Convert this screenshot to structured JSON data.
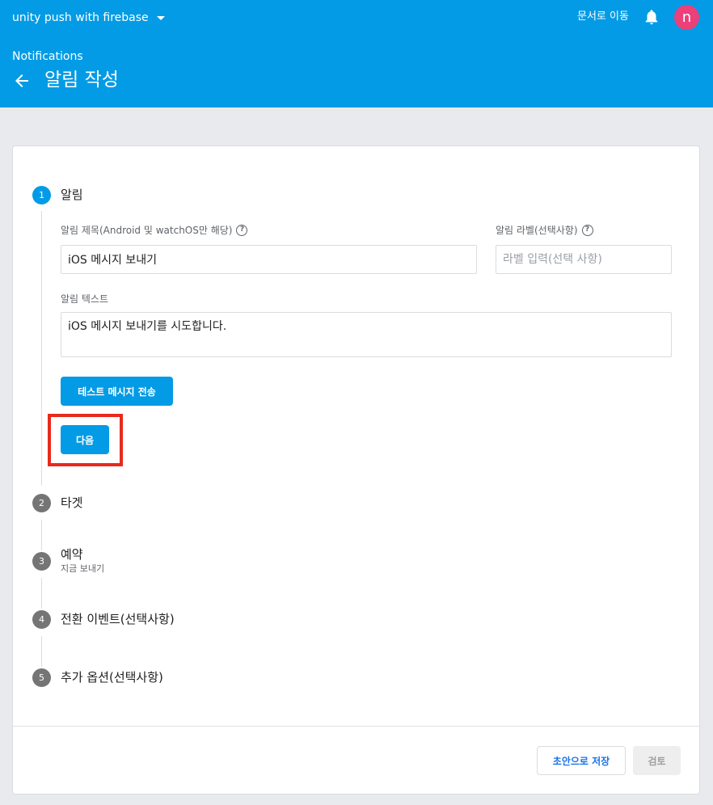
{
  "header": {
    "project_name": "unity push with firebase",
    "docs_link": "문서로 이동",
    "avatar_letter": "n",
    "breadcrumb": "Notifications",
    "page_title": "알림 작성"
  },
  "steps": [
    {
      "number": "1",
      "title": "알림",
      "subtitle": ""
    },
    {
      "number": "2",
      "title": "타겟",
      "subtitle": ""
    },
    {
      "number": "3",
      "title": "예약",
      "subtitle": "지금 보내기"
    },
    {
      "number": "4",
      "title": "전환 이벤트(선택사항)",
      "subtitle": ""
    },
    {
      "number": "5",
      "title": "추가 옵션(선택사항)",
      "subtitle": ""
    }
  ],
  "form": {
    "title_label": "알림 제목(Android 및 watchOS만 해당)",
    "title_value": "iOS 메시지 보내기",
    "label_label": "알림 라벨(선택사항)",
    "label_placeholder": "라벨 입력(선택 사항)",
    "text_label": "알림 텍스트",
    "text_value": "iOS 메시지 보내기를 시도합니다.",
    "help_glyph": "?",
    "test_button": "테스트 메시지 전송",
    "next_button": "다음"
  },
  "footer": {
    "save_draft": "초안으로 저장",
    "review": "검토"
  },
  "colors": {
    "header_bg": "#039be5",
    "primary": "#039be5",
    "avatar": "#ec407a",
    "highlight": "#e8291c",
    "inactive_step": "#757575"
  },
  "icons": {
    "project_dropdown": "caret-down-icon",
    "notifications": "bell-icon",
    "back": "arrow-left-icon",
    "help": "help-circle-icon"
  }
}
